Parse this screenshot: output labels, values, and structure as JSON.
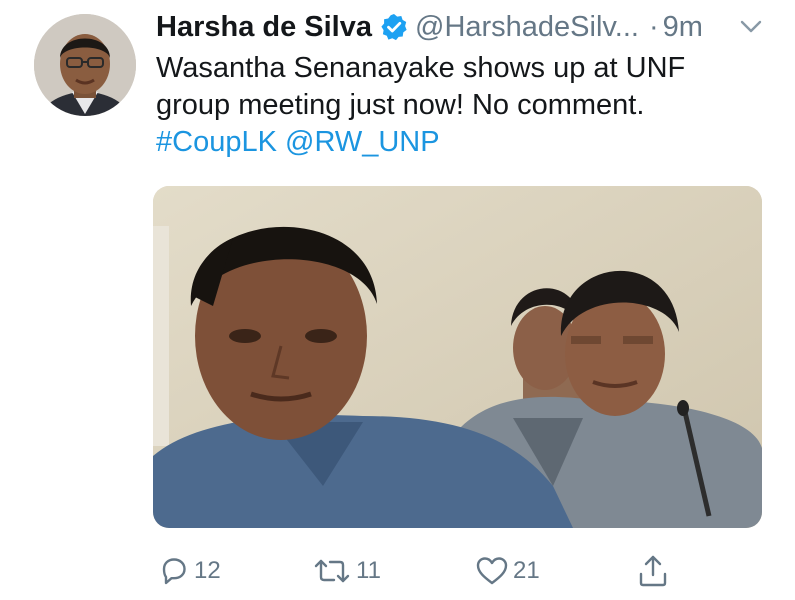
{
  "tweet": {
    "display_name": "Harsha de Silva",
    "handle": "@HarshadeSilv...",
    "separator": "·",
    "time": "9m",
    "text_lines": [
      "Wasantha Senanayake shows up at UNF",
      "group meeting just now! No comment."
    ],
    "hashtag": "#CoupLK",
    "mention": "@RW_UNP"
  },
  "actions": {
    "reply_count": "12",
    "retweet_count": "11",
    "like_count": "21"
  },
  "icons": {
    "verified": "verified-badge-icon",
    "menu": "chevron-down-icon",
    "reply": "reply-icon",
    "retweet": "retweet-icon",
    "like": "heart-icon",
    "share": "share-icon"
  },
  "colors": {
    "link": "#1b95e0",
    "secondary_text": "#657786",
    "verified": "#1da1f2"
  }
}
